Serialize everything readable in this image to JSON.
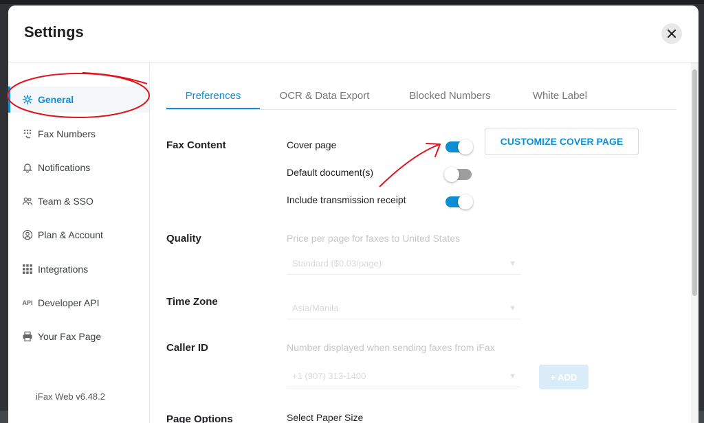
{
  "modal": {
    "title": "Settings"
  },
  "sidebar": {
    "items": [
      {
        "label": "General",
        "icon": "gear-icon"
      },
      {
        "label": "Fax Numbers",
        "icon": "phone-keypad-icon"
      },
      {
        "label": "Notifications",
        "icon": "bell-icon"
      },
      {
        "label": "Team & SSO",
        "icon": "team-icon"
      },
      {
        "label": "Plan & Account",
        "icon": "account-icon"
      },
      {
        "label": "Integrations",
        "icon": "grid-icon"
      },
      {
        "label": "Developer API",
        "icon": "api-icon"
      },
      {
        "label": "Your Fax Page",
        "icon": "fax-icon"
      }
    ],
    "version": "iFax Web v6.48.2"
  },
  "tabs": [
    "Preferences",
    "OCR & Data Export",
    "Blocked Numbers",
    "White Label"
  ],
  "fax_content": {
    "label": "Fax Content",
    "options": [
      {
        "label": "Cover page",
        "on": true
      },
      {
        "label": "Default document(s)",
        "on": false
      },
      {
        "label": "Include transmission receipt",
        "on": true
      }
    ],
    "customize_button": "CUSTOMIZE COVER PAGE"
  },
  "quality": {
    "label": "Quality",
    "hint": "Price per page for faxes to United States",
    "select": "Standard ($0.03/page)"
  },
  "time_zone": {
    "label": "Time Zone",
    "select": "Asia/Manila"
  },
  "caller_id": {
    "label": "Caller ID",
    "hint": "Number displayed when sending faxes from iFax",
    "select": "+1 (907) 313-1400",
    "add_button": "+ ADD"
  },
  "page_options": {
    "label": "Page Options",
    "hint": "Select Paper Size"
  },
  "colors": {
    "accent": "#0d8fd6",
    "annotation": "#e0141e"
  }
}
